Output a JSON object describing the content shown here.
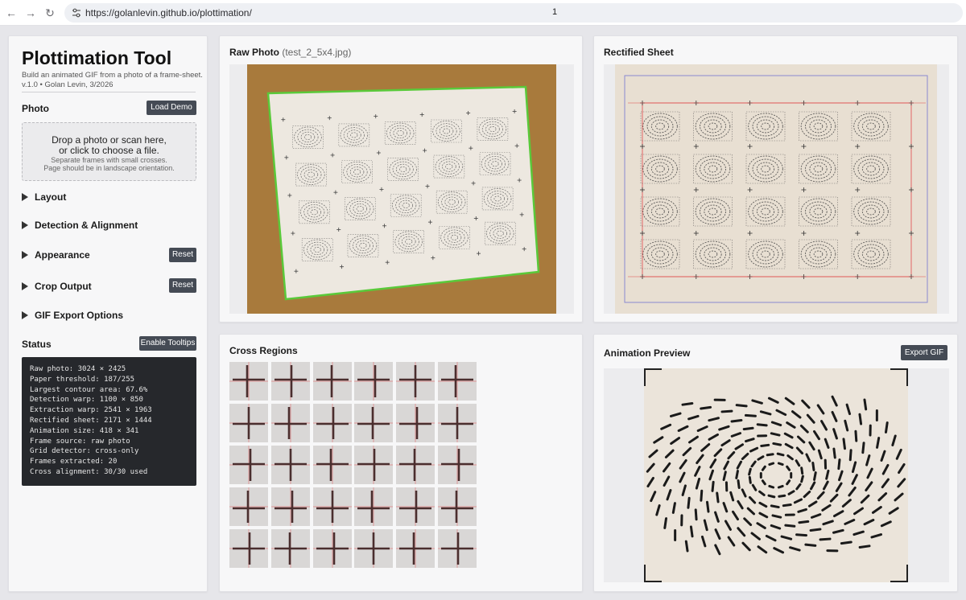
{
  "browser": {
    "url": "https://golanlevin.github.io/plottimation/",
    "cursor_text": "1"
  },
  "sidebar": {
    "title": "Plottimation Tool",
    "description_line1": "Build an animated GIF from a photo of a frame-sheet.",
    "description_line2": "v.1.0 • Golan Levin, 3/2026",
    "photo_label": "Photo",
    "load_demo": "Load Demo",
    "dropzone": {
      "line1": "Drop a photo or scan here,",
      "line2": "or click to choose a file.",
      "line3": "Separate frames with small crosses.",
      "line4": "Page should be in landscape orientation."
    },
    "sections": [
      {
        "label": "Layout"
      },
      {
        "label": "Detection & Alignment"
      },
      {
        "label": "Appearance",
        "button": "Reset"
      },
      {
        "label": "Crop Output",
        "button": "Reset"
      },
      {
        "label": "GIF Export Options"
      }
    ],
    "status_label": "Status",
    "tooltips_button": "Enable Tooltips",
    "status_lines": [
      "Raw photo: 3024 × 2425",
      "Paper threshold: 187/255",
      "Largest contour area: 67.6%",
      "Detection warp: 1100 × 850",
      "Extraction warp: 2541 × 1963",
      "Rectified sheet: 2171 × 1444",
      "Animation size: 418 × 341",
      "Frame source: raw photo",
      "Grid detector: cross-only",
      "Frames extracted: 20",
      "Cross alignment: 30/30 used"
    ]
  },
  "raw_panel": {
    "title": "Raw Photo",
    "subtitle": "(test_2_5x4.jpg)"
  },
  "rect_panel": {
    "title": "Rectified Sheet"
  },
  "cross_panel": {
    "title": "Cross Regions",
    "rows": 5,
    "cols": 6
  },
  "anim_panel": {
    "title": "Animation Preview",
    "export_button": "Export GIF"
  },
  "colors": {
    "button_bg": "#454b55",
    "paper": "#ede8e0",
    "cardboard": "#a87a3c",
    "detect_outline": "#5ac93a",
    "grid_red": "#e0484a",
    "grid_blue": "#8a8ad0",
    "status_bg": "#26282c"
  }
}
